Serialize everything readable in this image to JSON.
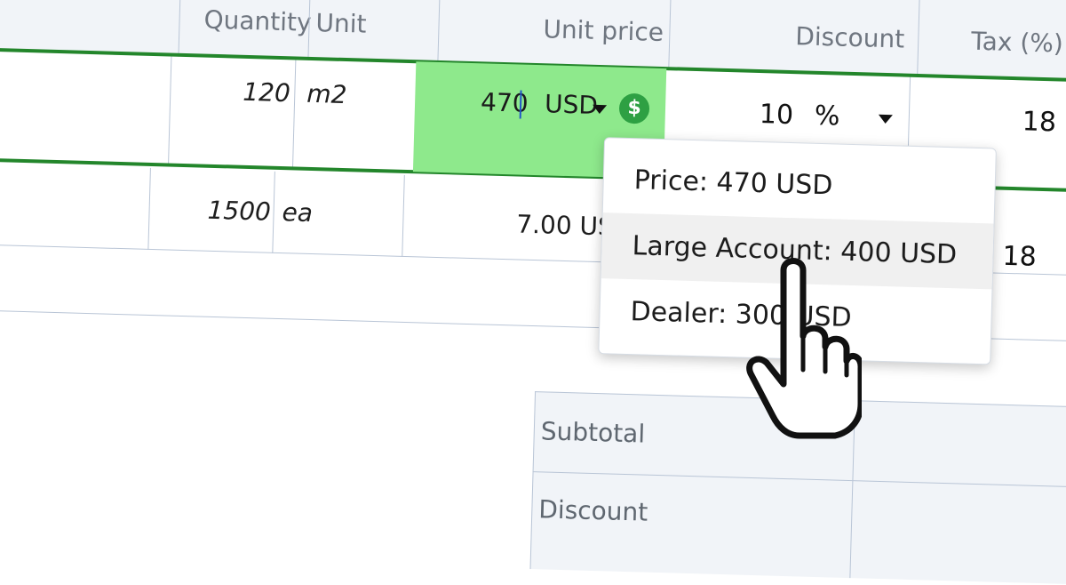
{
  "table": {
    "headers": [
      "Quantity",
      "Unit",
      "Unit price",
      "Discount",
      "Tax (%)"
    ],
    "rows": [
      {
        "quantity": "120",
        "unit": "m2",
        "unit_price": "470",
        "currency": "USD",
        "discount": "10",
        "discount_unit": "%",
        "tax": "18"
      },
      {
        "quantity": "1500",
        "unit": "ea",
        "unit_price": "7.00 US",
        "tax": "18"
      }
    ]
  },
  "price_dropdown": {
    "options": [
      "Price: 470 USD",
      "Large Account: 400 USD",
      "Dealer: 300 USD"
    ],
    "hover_index": 1
  },
  "totals": {
    "labels": [
      "Subtotal",
      "Discount"
    ]
  },
  "icons": {
    "currency": "dollar-icon",
    "cursor": "hand-pointer-icon"
  },
  "colors": {
    "active_cell": "#8ee98c",
    "row_border": "#23862b",
    "currency_icon": "#2ea043",
    "header_bg": "#f1f4f8"
  }
}
